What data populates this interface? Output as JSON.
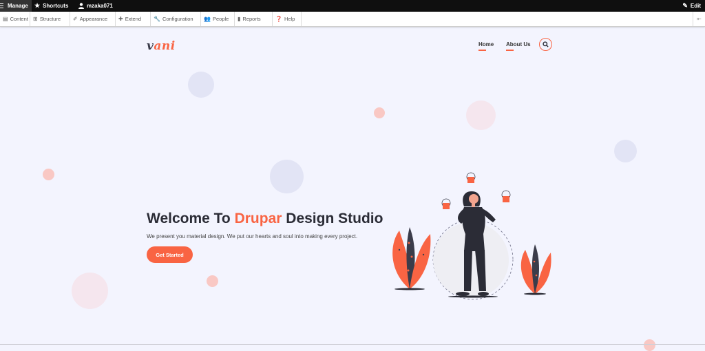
{
  "admin_toolbar": {
    "manage_label": "Manage",
    "shortcuts_label": "Shortcuts",
    "user_label": "mzaka071",
    "edit_label": "Edit"
  },
  "admin_menu": [
    {
      "label": "Content",
      "icon": "content-icon"
    },
    {
      "label": "Structure",
      "icon": "structure-icon"
    },
    {
      "label": "Appearance",
      "icon": "appearance-icon"
    },
    {
      "label": "Extend",
      "icon": "extend-icon"
    },
    {
      "label": "Configuration",
      "icon": "wrench-icon"
    },
    {
      "label": "People",
      "icon": "people-icon"
    },
    {
      "label": "Reports",
      "icon": "reports-icon"
    },
    {
      "label": "Help",
      "icon": "help-icon"
    }
  ],
  "site": {
    "logo_first": "v",
    "logo_rest": "ani",
    "nav": [
      {
        "label": "Home"
      },
      {
        "label": "About Us"
      }
    ]
  },
  "hero": {
    "title_pre": "Welcome To ",
    "title_accent": "Drupar",
    "title_post": " Design Studio",
    "subtitle": "We present you material design. We put our hearts and soul into making every project.",
    "cta_label": "Get Started"
  },
  "colors": {
    "accent": "#f96443",
    "dark": "#2b2c36",
    "background": "#f3f4fe"
  }
}
